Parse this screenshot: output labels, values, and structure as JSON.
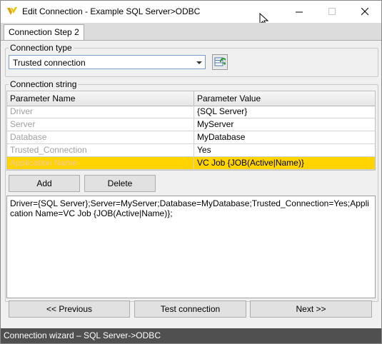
{
  "window": {
    "title": "Edit Connection - Example SQL Server>ODBC"
  },
  "tabs": [
    {
      "label": "Connection Step 2",
      "active": true
    }
  ],
  "connection_type": {
    "legend": "Connection type",
    "selected": "Trusted connection"
  },
  "connection_string_group": {
    "legend": "Connection string",
    "grid": {
      "columns": [
        "Parameter Name",
        "Parameter Value"
      ],
      "rows": [
        {
          "name": "Driver",
          "value": "{SQL Server}"
        },
        {
          "name": "Server",
          "value": "MyServer"
        },
        {
          "name": "Database",
          "value": "MyDatabase"
        },
        {
          "name": "Trusted_Connection",
          "value": "Yes"
        },
        {
          "name": "Application Name",
          "value": "VC Job {JOB(Active|Name)}",
          "selected": true
        }
      ]
    },
    "add_label": "Add",
    "delete_label": "Delete",
    "text": "Driver={SQL Server};Server=MyServer;Database=MyDatabase;Trusted_Connection=Yes;Application Name=VC Job {JOB(Active|Name)};"
  },
  "footer": {
    "previous_label": "<< Previous",
    "test_label": "Test connection",
    "next_label": "Next >>"
  },
  "status": {
    "text": "Connection wizard – SQL Server->ODBC"
  },
  "colors": {
    "selected_row": "#ffd400",
    "status_bar": "#505050"
  }
}
